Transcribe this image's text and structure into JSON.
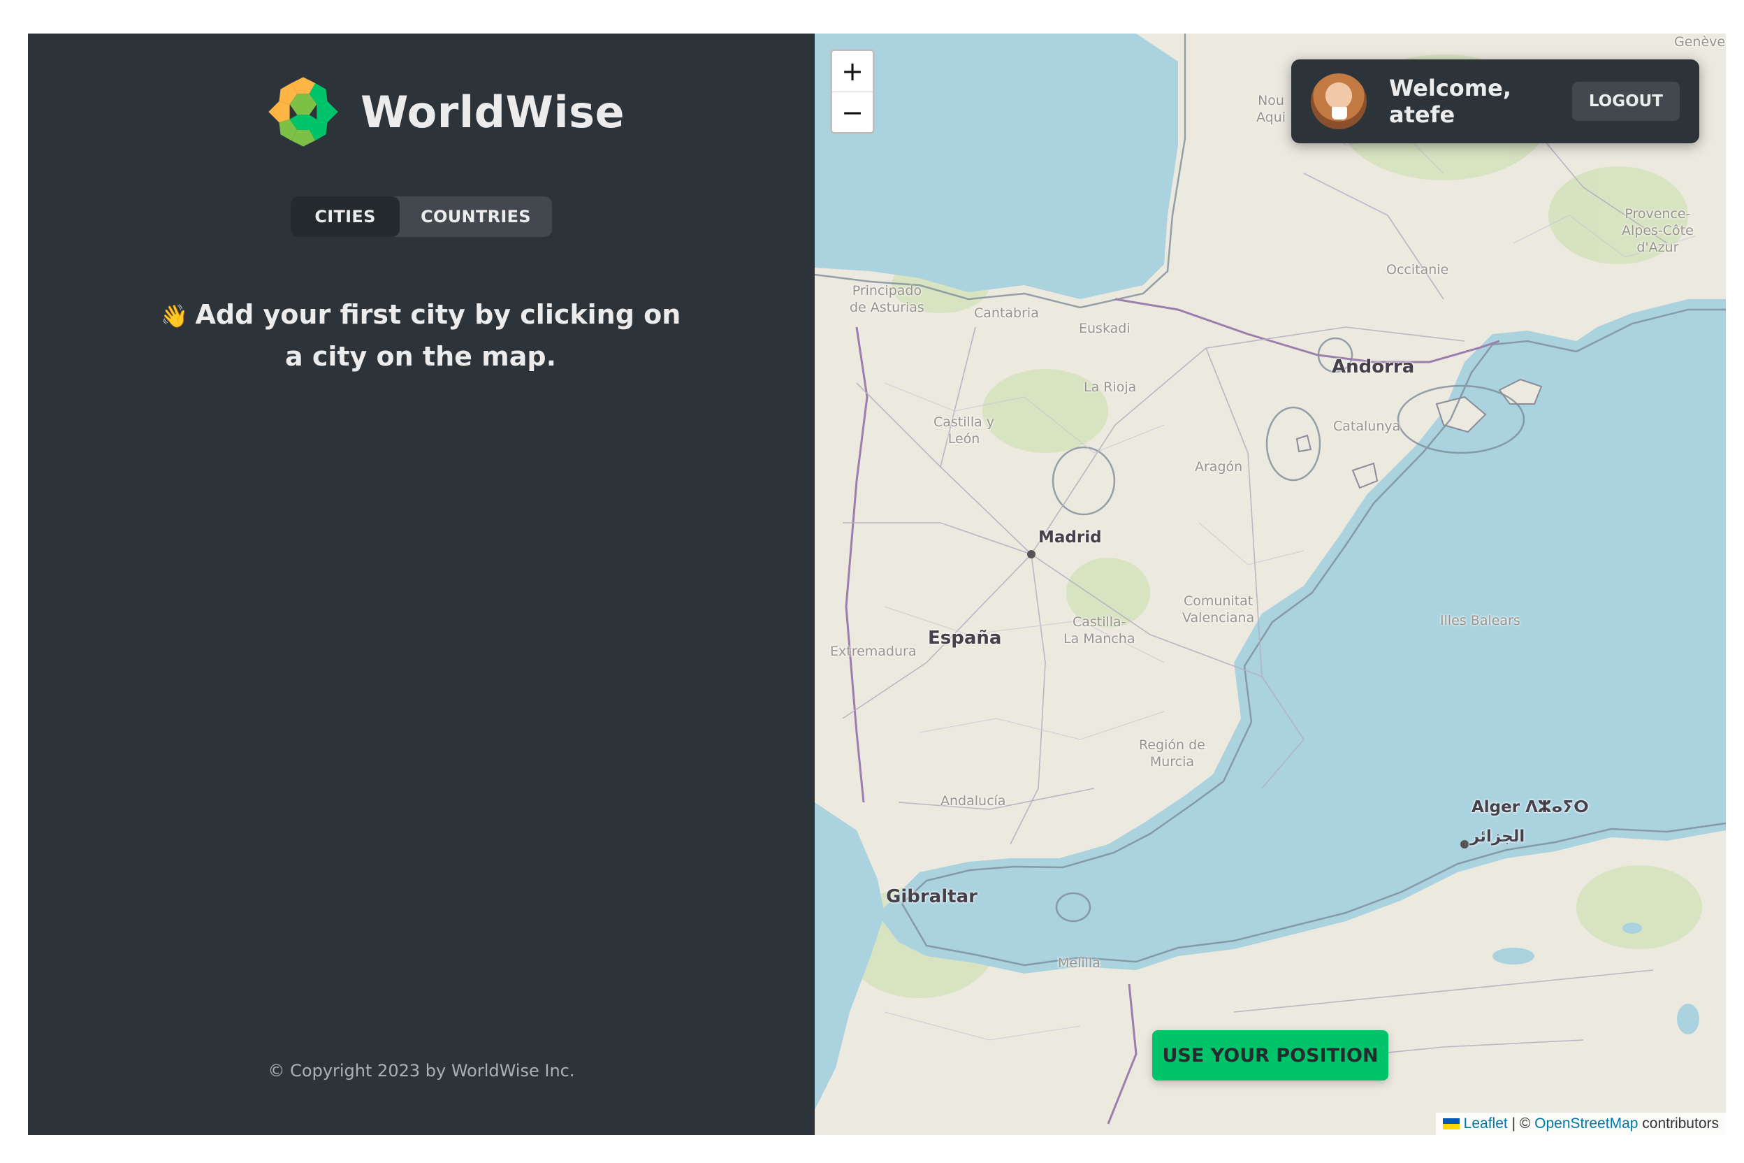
{
  "sidebar": {
    "logo_text": "WorldWise",
    "tabs": [
      {
        "label": "CITIES",
        "active": true
      },
      {
        "label": "COUNTRIES",
        "active": false
      }
    ],
    "wave_emoji": "👋",
    "message": "Add your first city by clicking on a city on the map.",
    "footer": "© Copyright 2023 by WorldWise Inc."
  },
  "map": {
    "zoom_in": "+",
    "zoom_out": "−",
    "user": {
      "welcome": "Welcome, atefe",
      "logout_label": "LOGOUT"
    },
    "geo_button": "USE YOUR POSITION",
    "attribution": {
      "leaflet": "Leaflet",
      "separator": " | © ",
      "osm": "OpenStreetMap",
      "suffix": " contributors"
    },
    "labels": {
      "madrid": "Madrid",
      "espana": "España",
      "andorra": "Andorra",
      "gibraltar": "Gibraltar",
      "alger": "Alger ⴷⵣⴰⵢⵔ",
      "algiers_ar": "الجزائر",
      "occitanie": "Occitanie",
      "catalunya": "Catalunya",
      "aragon": "Aragón",
      "la_rioja": "La Rioja",
      "euskadi": "Euskadi",
      "cantabria": "Cantabria",
      "asturias_1": "Principado",
      "asturias_2": "de Asturias",
      "castilla_leon_1": "Castilla y",
      "castilla_leon_2": "León",
      "extremadura": "Extremadura",
      "castilla_mancha_1": "Castilla-",
      "castilla_mancha_2": "La Mancha",
      "valenciana_1": "Comunitat",
      "valenciana_2": "Valenciana",
      "murcia_1": "Región de",
      "murcia_2": "Murcia",
      "andalucia": "Andalucía",
      "illes_balears": "Illes Balears",
      "melilla": "Melilla",
      "provence_1": "Provence-",
      "provence_2": "Alpes-Côte",
      "provence_3": "d'Azur",
      "nouvelle_1": "Nou",
      "nouvelle_2": "Aqui",
      "geneve": "Genève"
    }
  },
  "colors": {
    "sidebar_bg": "#2d3439",
    "tab_active": "#242a2e",
    "tab_inactive": "#42484d",
    "brand_green": "#00c46a",
    "brand_orange": "#ffb545",
    "sea": "#aad3df",
    "land": "#ece9df",
    "text_light": "#ececec"
  }
}
